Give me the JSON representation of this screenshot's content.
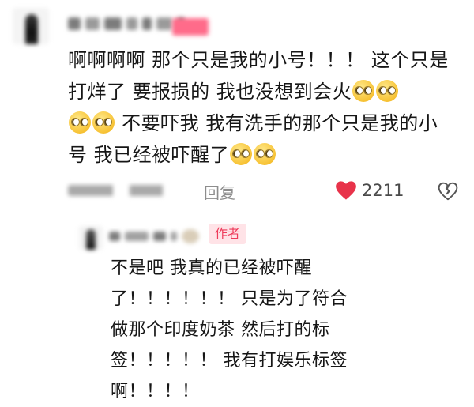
{
  "main_comment": {
    "text": "啊啊啊啊 那个只是我的小号！！！ 这个只是打烊了 要报损的 我也没想到会火",
    "text_2": "不要吓我 我有洗手的那个只是我的小号 我已经被吓醒了",
    "reply_label": "回复",
    "like_count": "2211"
  },
  "reply_comment": {
    "author_badge": "作者",
    "text": "不是吧 我真的已经被吓醒\n了！！！！！！ 只是为了符合做那个印度奶茶 然后打的标签！！！！！ 我有打娱乐标签啊！！！！"
  },
  "colors": {
    "heart": "#e8334a",
    "badge_text": "#ee3b5a",
    "badge_bg": "#ffe3e7"
  },
  "icons": {
    "emoji": "flushed-face-emoji",
    "like": "heart-icon",
    "dislike": "broken-heart-icon"
  }
}
